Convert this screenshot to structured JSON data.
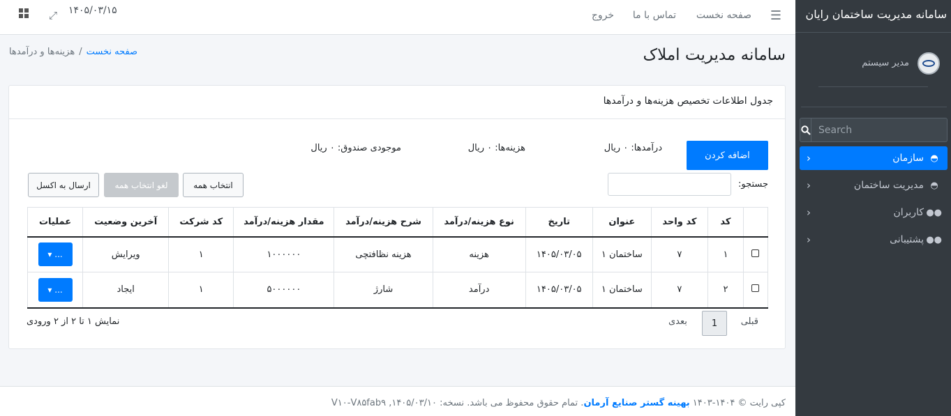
{
  "sidebar": {
    "brand": "سامانه مدیریت ساختمان رایان",
    "user": "مدیر سیستم",
    "search_placeholder": "Search",
    "items": [
      {
        "label": "سازمان",
        "icon": "tachometer-icon",
        "active": true
      },
      {
        "label": "مدیریت ساختمان",
        "icon": "tachometer-icon"
      },
      {
        "label": "کاربران",
        "icon": "users-icon"
      },
      {
        "label": "پشتیبانی",
        "icon": "users-icon"
      }
    ]
  },
  "topbar": {
    "links": [
      "صفحه نخست",
      "تماس با ما",
      "خروج"
    ],
    "date": "۱۴۰۵/۰۳/۱۵"
  },
  "page": {
    "title": "سامانه مدیریت املاک",
    "breadcrumb": {
      "home": "صفحه نخست",
      "current": "هزینه‌ها و درآمدها"
    }
  },
  "card": {
    "header": "جدول اطلاعات تخصیص هزینه‌ها و درآمدها",
    "add_button": "اضافه کردن",
    "stats": {
      "income": "درآمدها: ۰ ریال",
      "expenses": "هزینه‌ها: ۰ ریال",
      "balance": "موجودی صندوق: ۰ ریال"
    },
    "search_label": "جستجو:",
    "buttons": {
      "select_all": "انتخاب همه",
      "deselect_all": "لغو انتخاب همه",
      "export_excel": "ارسال به اکسل"
    },
    "columns": [
      "",
      "کد",
      "کد واحد",
      "عنوان",
      "تاریخ",
      "نوع هزینه/درآمد",
      "شرح هزینه/درآمد",
      "مقدار هزینه/درآمد",
      "کد شرکت",
      "آخرین وضعیت",
      "عملیات"
    ],
    "rows": [
      [
        "۱",
        "۷",
        "ساختمان ۱",
        "۱۴۰۵/۰۳/۰۵",
        "هزینه",
        "هزینه نظافتچی",
        "۱۰۰۰۰۰۰",
        "۱",
        "ویرایش"
      ],
      [
        "۲",
        "۷",
        "ساختمان ۱",
        "۱۴۰۵/۰۳/۰۵",
        "درآمد",
        "شارژ",
        "۵۰۰۰۰۰۰",
        "۱",
        "ایجاد"
      ]
    ],
    "ops_label": "...",
    "pagination": {
      "prev": "قبلی",
      "page": "1",
      "next": "بعدی"
    },
    "info": "نمایش ۱ تا ۲ از ۲ ورودی"
  },
  "footer": {
    "copyright": "کپی رایت © ۱۴۰۴-۱۴۰۳",
    "company": "بهینه گستر صنایع آرمان",
    "rest": ". تمام حقوق محفوظ می باشد. نسخه: ۱۴۰۵/۰۳/۱۰, V۱۰-V۸۵fab۹"
  }
}
